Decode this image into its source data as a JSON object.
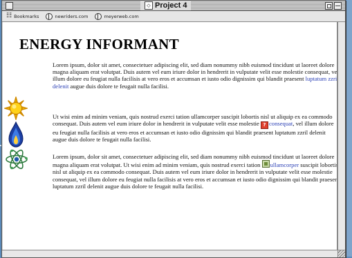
{
  "window": {
    "title": "Project 4"
  },
  "toolbar": {
    "items": [
      {
        "label": "Bookmarks",
        "icon": "bookmarks-icon"
      },
      {
        "label": "newriders.com",
        "icon": "globe-icon"
      },
      {
        "label": "meyerweb.com",
        "icon": "globe-icon"
      }
    ]
  },
  "page": {
    "heading": "ENERGY INFORMANT",
    "paragraph1": {
      "text": "Lorem ipsum, dolor sit amet, consectetuer adipiscing elit, sed diam nonummy nibh euismod tincidunt ut laoreet dolore magna aliquam erat volutpat. Duis autem vel eum iriure dolor in hendrerit in vulputate velit esse molestie consequat, vel illum dolore eu feugiat nulla facilisis at vero eros et accumsan et iusto odio dignissim qui blandit praesent ",
      "link": "luptatum zzril delenit",
      "after": " augue duis dolore te feugait nulla facilisi."
    },
    "paragraph2": {
      "before": "Ut wisi enim ad minim veniam, quis nostrud exerci tation ullamcorper suscipit lobortis nisl ut aliquip ex ea commodo consequat. Duis autem vel eum iriure dolor in hendrerit in vulputate velit esse molestie ",
      "icon_glyph": "?",
      "link": "consequat",
      "after": ", vel illum dolore eu feugiat nulla facilisis at vero eros et accumsan et iusto odio dignissim qui blandit praesent luptatum zzril delenit augue duis dolore te feugait nulla facilisi."
    },
    "paragraph3": {
      "before": "Lorem ipsum, dolor sit amet, consectetuer adipiscing elit, sed diam nonummy nibh euismod tincidunt ut laoreet dolore magna aliquam erat volutpat. Ut wisi enim ad minim veniam, quis nostrud exerci tation ",
      "link": "ullamcorper",
      "after": " suscipit lobortis nisl ut aliquip ex ea commodo consequat. Duis autem vel eum iriure dolor in hendrerit in vulputate velit esse molestie consequat, vel illum dolore eu feugiat nulla facilisis at vero eros et accumsan et iusto odio dignissim qui blandit praesent luptatum zzril delenit augue duis dolore te feugait nulla facilisi."
    },
    "side_icons": [
      "sun-icon",
      "flame-icon",
      "atom-icon"
    ]
  },
  "colors": {
    "desktop": "#5b8ab9",
    "link": "#2a3fb5",
    "help_icon": "#e0402e"
  }
}
